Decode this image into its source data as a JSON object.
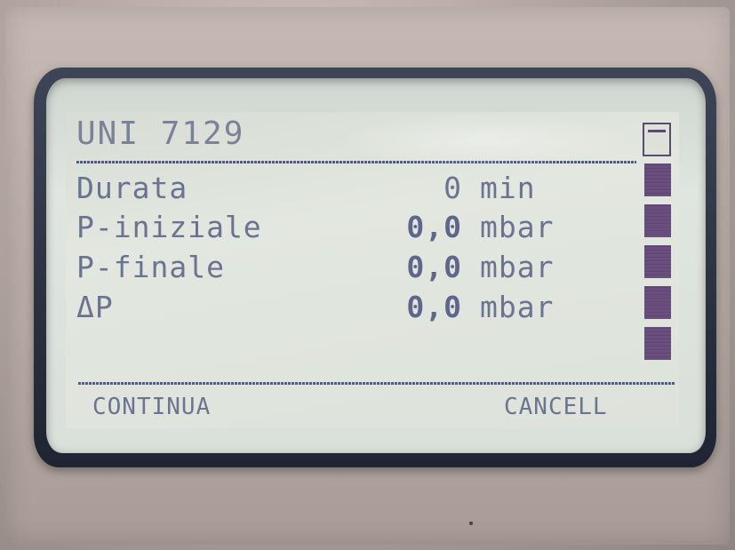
{
  "screen": {
    "title": "UNI 7129",
    "rows": [
      {
        "label": "Durata",
        "value": "0",
        "unit": "min"
      },
      {
        "label": "P-iniziale",
        "value": "0,0",
        "unit": "mbar"
      },
      {
        "label": "P-finale",
        "value": "0,0",
        "unit": "mbar"
      },
      {
        "label": "ΔP",
        "value": "0,0",
        "unit": "mbar"
      }
    ],
    "softkeys": {
      "left": "CONTINUA",
      "right": "CANCELL"
    }
  },
  "colors": {
    "lcd_background": "#dde2da",
    "lcd_text": "#5b6486",
    "bezel": "#2c3242",
    "scroll_blocks": "#6a4f7e"
  },
  "icons": {
    "scroll_indicator": "scroll-thumb-icon"
  }
}
